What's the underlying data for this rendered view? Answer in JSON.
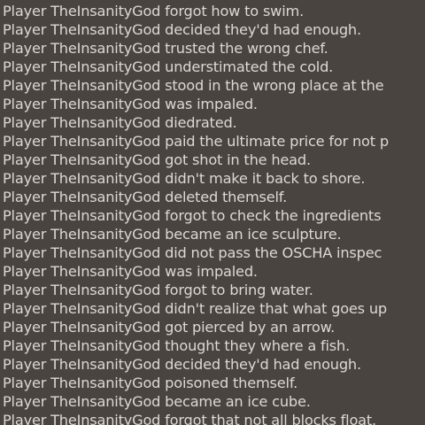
{
  "chat": {
    "lines": [
      "Player TheInsanityGod forgot how to swim.",
      "Player TheInsanityGod decided they'd had enough.",
      "Player TheInsanityGod trusted the wrong chef.",
      "Player TheInsanityGod understimated the cold.",
      "Player TheInsanityGod stood in the wrong place at the",
      "Player TheInsanityGod was impaled.",
      "Player TheInsanityGod diedrated.",
      "Player TheInsanityGod paid the ultimate price for not p",
      "Player TheInsanityGod got shot in the head.",
      "Player TheInsanityGod didn't make it back to shore.",
      "Player TheInsanityGod deleted themself.",
      "Player TheInsanityGod forgot to check the ingredients",
      "Player TheInsanityGod became an ice sculpture.",
      "Player TheInsanityGod did not pass the OSCHA inspec",
      "Player TheInsanityGod was impaled.",
      "Player TheInsanityGod forgot to bring water.",
      "Player TheInsanityGod didn't realize that what goes up",
      "Player TheInsanityGod got pierced by an arrow.",
      "Player TheInsanityGod thought they where a fish.",
      "Player TheInsanityGod decided they'd had enough.",
      "Player TheInsanityGod poisoned themself.",
      "Player TheInsanityGod became an ice cube.",
      "Player TheInsanityGod forgot that not all blocks float."
    ]
  },
  "colors": {
    "background": "#4a4440",
    "text": "#dcd8d2"
  }
}
